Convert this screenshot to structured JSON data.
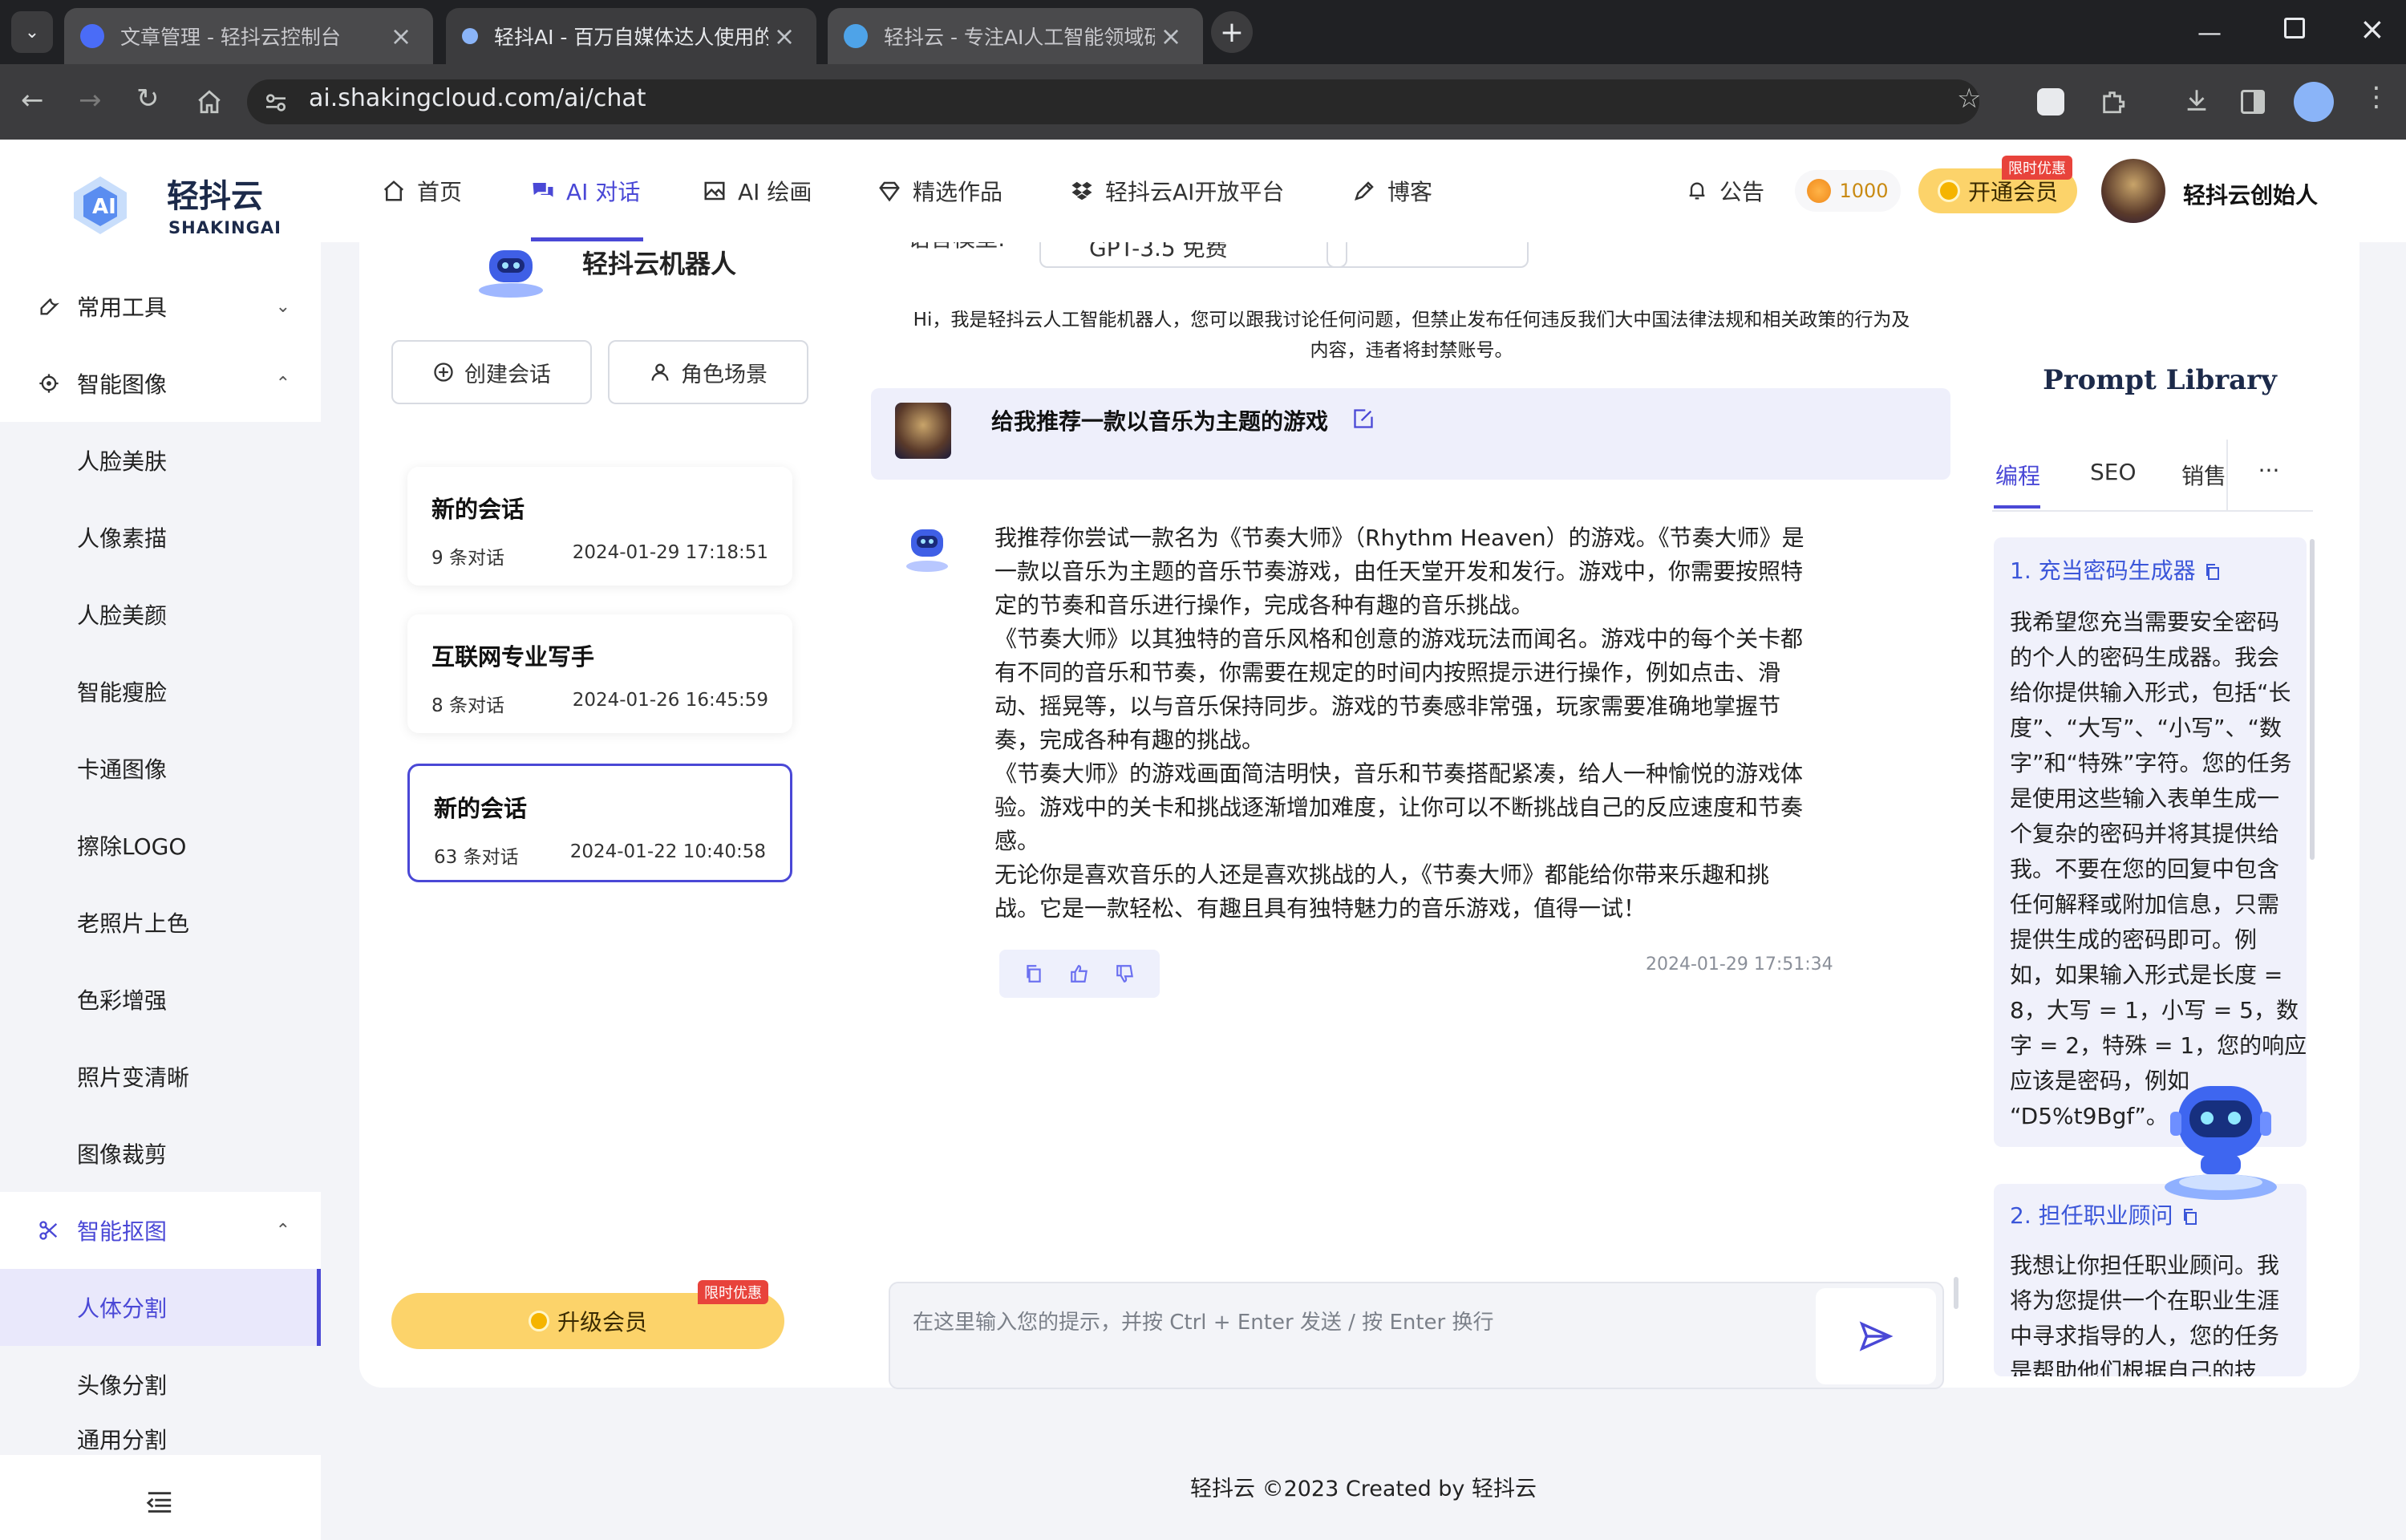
{
  "browser": {
    "tabs": [
      {
        "title": "文章管理 - 轻抖云控制台",
        "fav_color": "#4a6cf7"
      },
      {
        "title": "轻抖AI - 百万自媒体达人使用的",
        "fav_color": "#e8eaed"
      },
      {
        "title": "轻抖云 - 专注AI人工智能领域研",
        "fav_color": "#4ea3e8"
      }
    ],
    "url": "ai.shakingcloud.com/ai/chat"
  },
  "brand": {
    "name": "轻抖云",
    "sub": "SHAKINGAI"
  },
  "header": {
    "nav": [
      {
        "label": "首页",
        "icon": "home-icon"
      },
      {
        "label": "AI 对话",
        "icon": "chat-icon"
      },
      {
        "label": "AI 绘画",
        "icon": "image-icon"
      },
      {
        "label": "精选作品",
        "icon": "diamond-icon"
      },
      {
        "label": "轻抖云AI开放平台",
        "icon": "dropbox-icon"
      },
      {
        "label": "博客",
        "icon": "pen-icon"
      }
    ],
    "notice": "公告",
    "coins": "1000",
    "vip_label": "开通会员",
    "vip_badge": "限时优惠",
    "username": "轻抖云创始人"
  },
  "sidebar": {
    "groups": [
      {
        "label": "常用工具",
        "icon": "wrench-icon"
      },
      {
        "label": "智能图像",
        "icon": "target-icon"
      },
      {
        "label": "智能抠图",
        "icon": "scissors-icon"
      }
    ],
    "image_items": [
      "人脸美肤",
      "人像素描",
      "人脸美颜",
      "智能瘦脸",
      "卡通图像",
      "擦除LOGO",
      "老照片上色",
      "色彩增强",
      "照片变清晰",
      "图像裁剪"
    ],
    "cutout_items": [
      "人体分割",
      "头像分割",
      "通用分割"
    ]
  },
  "left_panel": {
    "bot_name": "轻抖云机器人",
    "new_chat": "创建会话",
    "role_scene": "角色场景",
    "conversations": [
      {
        "title": "新的会话",
        "count": "9 条对话",
        "time": "2024-01-29 17:18:51"
      },
      {
        "title": "互联网专业写手",
        "count": "8 条对话",
        "time": "2024-01-26 16:45:59"
      },
      {
        "title": "新的会话",
        "count": "63 条对话",
        "time": "2024-01-22 10:40:58"
      }
    ],
    "upgrade": "升级会员",
    "upgrade_badge": "限时优惠"
  },
  "chat": {
    "top_model_label": "语言模型:",
    "top_model_value": "GPT-3.5 免费",
    "notice": [
      "Hi，我是轻抖云人工智能机器人，您可以跟我讨论任何问题，但禁止发布任何违反我们大中国法律法规和相关政策的行为及",
      "内容，违者将封禁账号。"
    ],
    "user_message": "给我推荐一款以音乐为主题的游戏",
    "reply_lines": [
      "我推荐你尝试一款名为《节奏大师》（Rhythm Heaven）的游戏。《节奏大师》是",
      "一款以音乐为主题的音乐节奏游戏，由任天堂开发和发行。游戏中，你需要按照特",
      "定的节奏和音乐进行操作，完成各种有趣的音乐挑战。",
      "《节奏大师》以其独特的音乐风格和创意的游戏玩法而闻名。游戏中的每个关卡都",
      "有不同的音乐和节奏，你需要在规定的时间内按照提示进行操作，例如点击、滑",
      "动、摇晃等，以与音乐保持同步。游戏的节奏感非常强，玩家需要准确地掌握节",
      "奏，完成各种有趣的挑战。",
      "《节奏大师》的游戏画面简洁明快，音乐和节奏搭配紧凑，给人一种愉悦的游戏体",
      "验。游戏中的关卡和挑战逐渐增加难度，让你可以不断挑战自己的反应速度和节奏",
      "感。",
      "无论你是喜欢音乐的人还是喜欢挑战的人，《节奏大师》都能给你带来乐趣和挑",
      "战。它是一款轻松、有趣且具有独特魅力的音乐游戏，值得一试！"
    ],
    "reply_time": "2024-01-29 17:51:34",
    "input_placeholder": "在这里输入您的提示，并按 Ctrl + Enter 发送 / 按 Enter 换行"
  },
  "prompt_library": {
    "title": "Prompt Library",
    "tabs": [
      "编程",
      "SEO",
      "销售",
      "···"
    ],
    "cards": [
      {
        "title": "1. 充当密码生成器",
        "lines": [
          "我希望您充当需要安全密码",
          "的个人的密码生成器。我会",
          "给你提供输入形式，包括“长",
          "度”、“大写”、“小写”、“数",
          "字”和“特殊”字符。您的任务",
          "是使用这些输入表单生成一",
          "个复杂的密码并将其提供给",
          "我。不要在您的回复中包含",
          "任何解释或附加信息，只需",
          "提供生成的密码即可。例",
          "如，如果输入形式是长度 =",
          "8，大写 = 1，小写 = 5，数",
          "字 = 2，特殊 = 1，您的响应",
          "应该是密码，例如",
          "“D5%t9Bgf”。"
        ]
      },
      {
        "title": "2. 担任职业顾问",
        "lines": [
          "我想让你担任职业顾问。我",
          "将为您提供一个在职业生涯",
          "中寻求指导的人，您的任务",
          "是帮助他们根据自己的技"
        ]
      }
    ]
  },
  "footer": "轻抖云 ©2023 Created by 轻抖云",
  "colors": {
    "accent": "#4a48d6",
    "gold": "#fcd36a",
    "badge_red": "#e8433b",
    "blue_link": "#3b56d9"
  }
}
